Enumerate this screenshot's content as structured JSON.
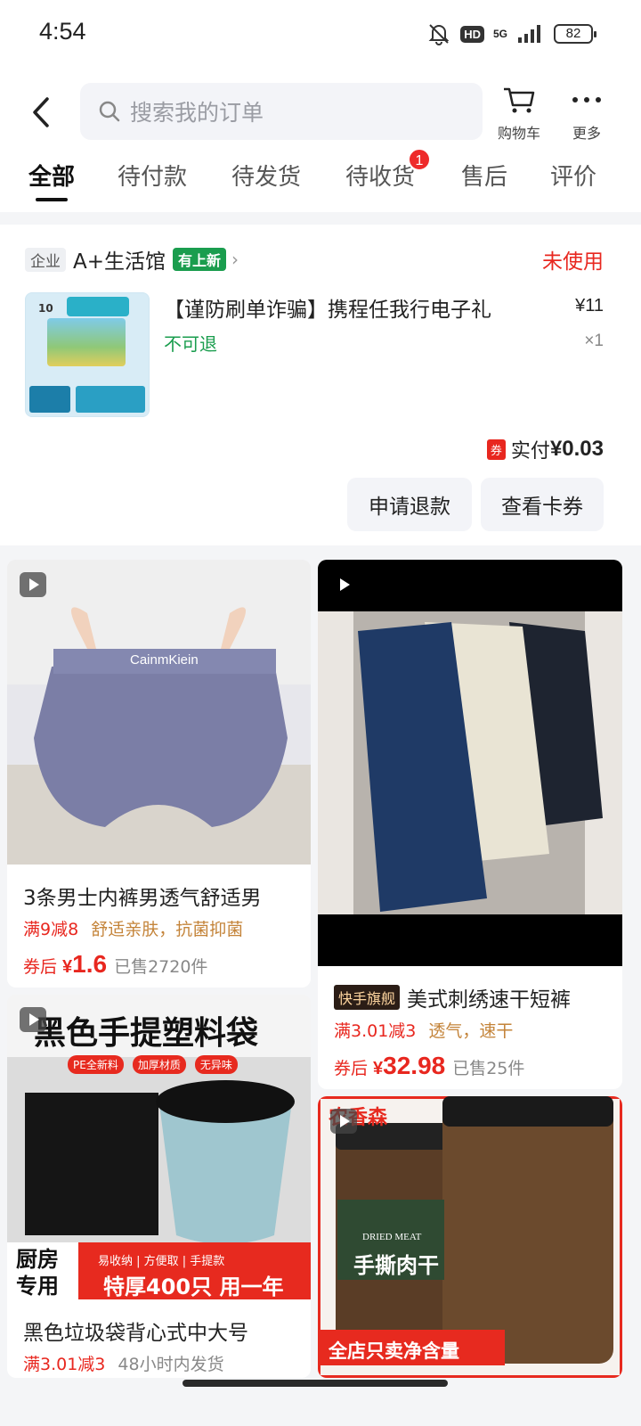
{
  "status_bar": {
    "time": "4:54",
    "network": "5G",
    "hd": "HD",
    "battery": "82"
  },
  "header": {
    "search_placeholder": "搜索我的订单",
    "cart_label": "购物车",
    "more_label": "更多"
  },
  "tabs": [
    {
      "label": "全部",
      "active": true
    },
    {
      "label": "待付款"
    },
    {
      "label": "待发货"
    },
    {
      "label": "待收货",
      "badge": "1"
    },
    {
      "label": "售后"
    },
    {
      "label": "评价"
    }
  ],
  "order": {
    "shop_type": "企业",
    "shop_name": "A+生活馆",
    "shop_tag": "有上新",
    "status": "未使用",
    "item": {
      "thumb_text": "10",
      "title": "【谨防刷单诈骗】携程任我行电子礼",
      "price": "¥11",
      "qty": "×1",
      "tag": "不可退"
    },
    "coupon_icon": "券",
    "paid_label": "实付",
    "paid_amount": "¥0.03",
    "buttons": [
      "申请退款",
      "查看卡券"
    ]
  },
  "feed": [
    {
      "image_text": "CainmKiein",
      "title": "3条男士内裤男透气舒适男",
      "promo": "满9减8",
      "feature": "舒适亲肤，抗菌抑菌",
      "price_prefix": "券后",
      "yen": "¥",
      "price": "1.6",
      "sold": "已售2720件"
    },
    {
      "brand_tag": "快手旗舰",
      "title": "美式刺绣速干短裤",
      "promo": "满3.01减3",
      "feature": "透气，速干",
      "price_prefix": "券后",
      "yen": "¥",
      "price": "32.98",
      "sold": "已售25件"
    },
    {
      "image_heading": "黑色手提塑料袋",
      "image_badges": [
        "PE全新料",
        "加厚材质",
        "无异味"
      ],
      "image_corner": "厨房专用",
      "image_features": "易收纳 | 方便取 | 手提款",
      "image_banner": "特厚400只 用一年",
      "title": "黑色垃圾袋背心式中大号",
      "promo": "满3.01减3",
      "feature": "48小时内发货"
    },
    {
      "image_brand": "农香森",
      "image_label": "DRIED MEAT",
      "image_product": "手撕肉干",
      "image_banner": "全店只卖净含量"
    }
  ]
}
